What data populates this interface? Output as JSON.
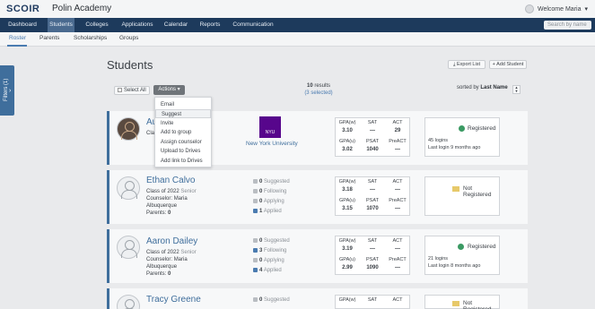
{
  "header": {
    "logo": "SCOIR",
    "org": "Polin Academy",
    "welcome": "Welcome Maria"
  },
  "nav": {
    "items": [
      "Dashboard",
      "Students",
      "Colleges",
      "Applications",
      "Calendar",
      "Reports",
      "Communication"
    ],
    "active": "Students",
    "search_placeholder": "Search by name"
  },
  "subnav": {
    "items": [
      "Roster",
      "Parents",
      "Scholarships",
      "Groups"
    ],
    "active": "Roster"
  },
  "filters": {
    "label": "Filters (1)"
  },
  "page": {
    "title": "Students",
    "export_label": "Export List",
    "add_label": "+ Add Student",
    "select_all": "Select All",
    "actions": "Actions",
    "results_count": "10",
    "results_label": "results",
    "selected": "(3 selected)",
    "sort_prefix": "sorted by",
    "sort_field": "Last Name"
  },
  "actions_menu": [
    "Email",
    "Suggest",
    "Invite",
    "Add to group",
    "Assign counselor",
    "Upload to Drives",
    "Add link to Drives"
  ],
  "labels": {
    "gpa_w": "GPA(w)",
    "gpa_u": "GPA(u)",
    "sat": "SAT",
    "psat": "PSAT",
    "act": "ACT",
    "preact": "PreACT",
    "suggested": "Suggested",
    "following": "Following",
    "applying": "Applying",
    "applied": "Applied",
    "counselor": "Counselor:",
    "parents": "Parents:"
  },
  "students": [
    {
      "name": "Au",
      "class": "Class",
      "college": "New York University",
      "college_logo_text": "NYU",
      "gpa_w": "3.10",
      "sat": "—",
      "act": "29",
      "gpa_u": "3.02",
      "psat": "1040",
      "preact": "—",
      "status": "Registered",
      "logins": "45 logins",
      "last_login": "Last login 9 months ago"
    },
    {
      "name": "Ethan Calvo",
      "class": "Class of 2022",
      "level": "Senior",
      "counselor": "Maria",
      "city": "Albuquerque",
      "parents": "0",
      "suggested": "0",
      "following": "0",
      "applying": "0",
      "applied": "1",
      "gpa_w": "3.18",
      "sat": "—",
      "act": "—",
      "gpa_u": "3.15",
      "psat": "1070",
      "preact": "—",
      "status": "Not Registered"
    },
    {
      "name": "Aaron Dailey",
      "class": "Class of 2022",
      "level": "Senior",
      "counselor": "Maria",
      "city": "Albuquerque",
      "parents": "0",
      "suggested": "0",
      "following": "3",
      "applying": "0",
      "applied": "4",
      "gpa_w": "3.19",
      "sat": "—",
      "act": "—",
      "gpa_u": "2.99",
      "psat": "1090",
      "preact": "—",
      "status": "Registered",
      "logins": "21 logins",
      "last_login": "Last login 8 months ago"
    },
    {
      "name": "Tracy Greene",
      "suggested": "0",
      "status": "Not Registered"
    }
  ]
}
